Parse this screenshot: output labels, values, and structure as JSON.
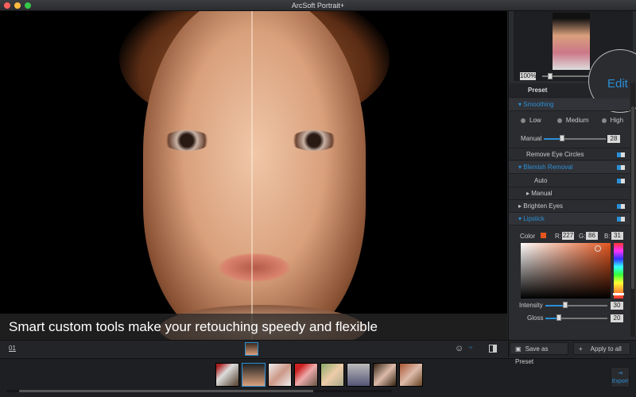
{
  "window": {
    "title": "ArcSoft Portrait+"
  },
  "photo": {
    "caption": "Smart custom tools make your retouching speedy and flexible"
  },
  "bottom": {
    "page_number": "01",
    "save_preset": "Save as Preset",
    "apply_all": "Apply to all"
  },
  "navigator": {
    "zoom": "100%",
    "zoom_slider": 0.1
  },
  "tabs": [
    {
      "label": "Preset"
    },
    {
      "label": "Edit"
    }
  ],
  "smoothing": {
    "label": "Smoothing",
    "options": [
      "Low",
      "Medium",
      "High"
    ],
    "manual_label": "Manual",
    "manual_value": "28",
    "manual_fraction": 0.28
  },
  "items": {
    "remove_eye_circles": "Remove Eye Circles",
    "blemish": "Blemish Removal",
    "auto": "Auto",
    "manual": "Manual",
    "brighten_eyes": "Brighten Eyes",
    "lipstick": "Lipstick"
  },
  "lipstick": {
    "color_label": "Color",
    "r_label": "R:",
    "r": "227",
    "g_label": "G:",
    "g": "86",
    "b_label": "B:",
    "b": "31",
    "color": "#e3561f",
    "intensity_label": "Intensity",
    "intensity": "30",
    "gloss_label": "Gloss",
    "gloss": "20"
  },
  "export": {
    "label": "Export"
  },
  "colors": {
    "accent": "#2a8fd6"
  }
}
